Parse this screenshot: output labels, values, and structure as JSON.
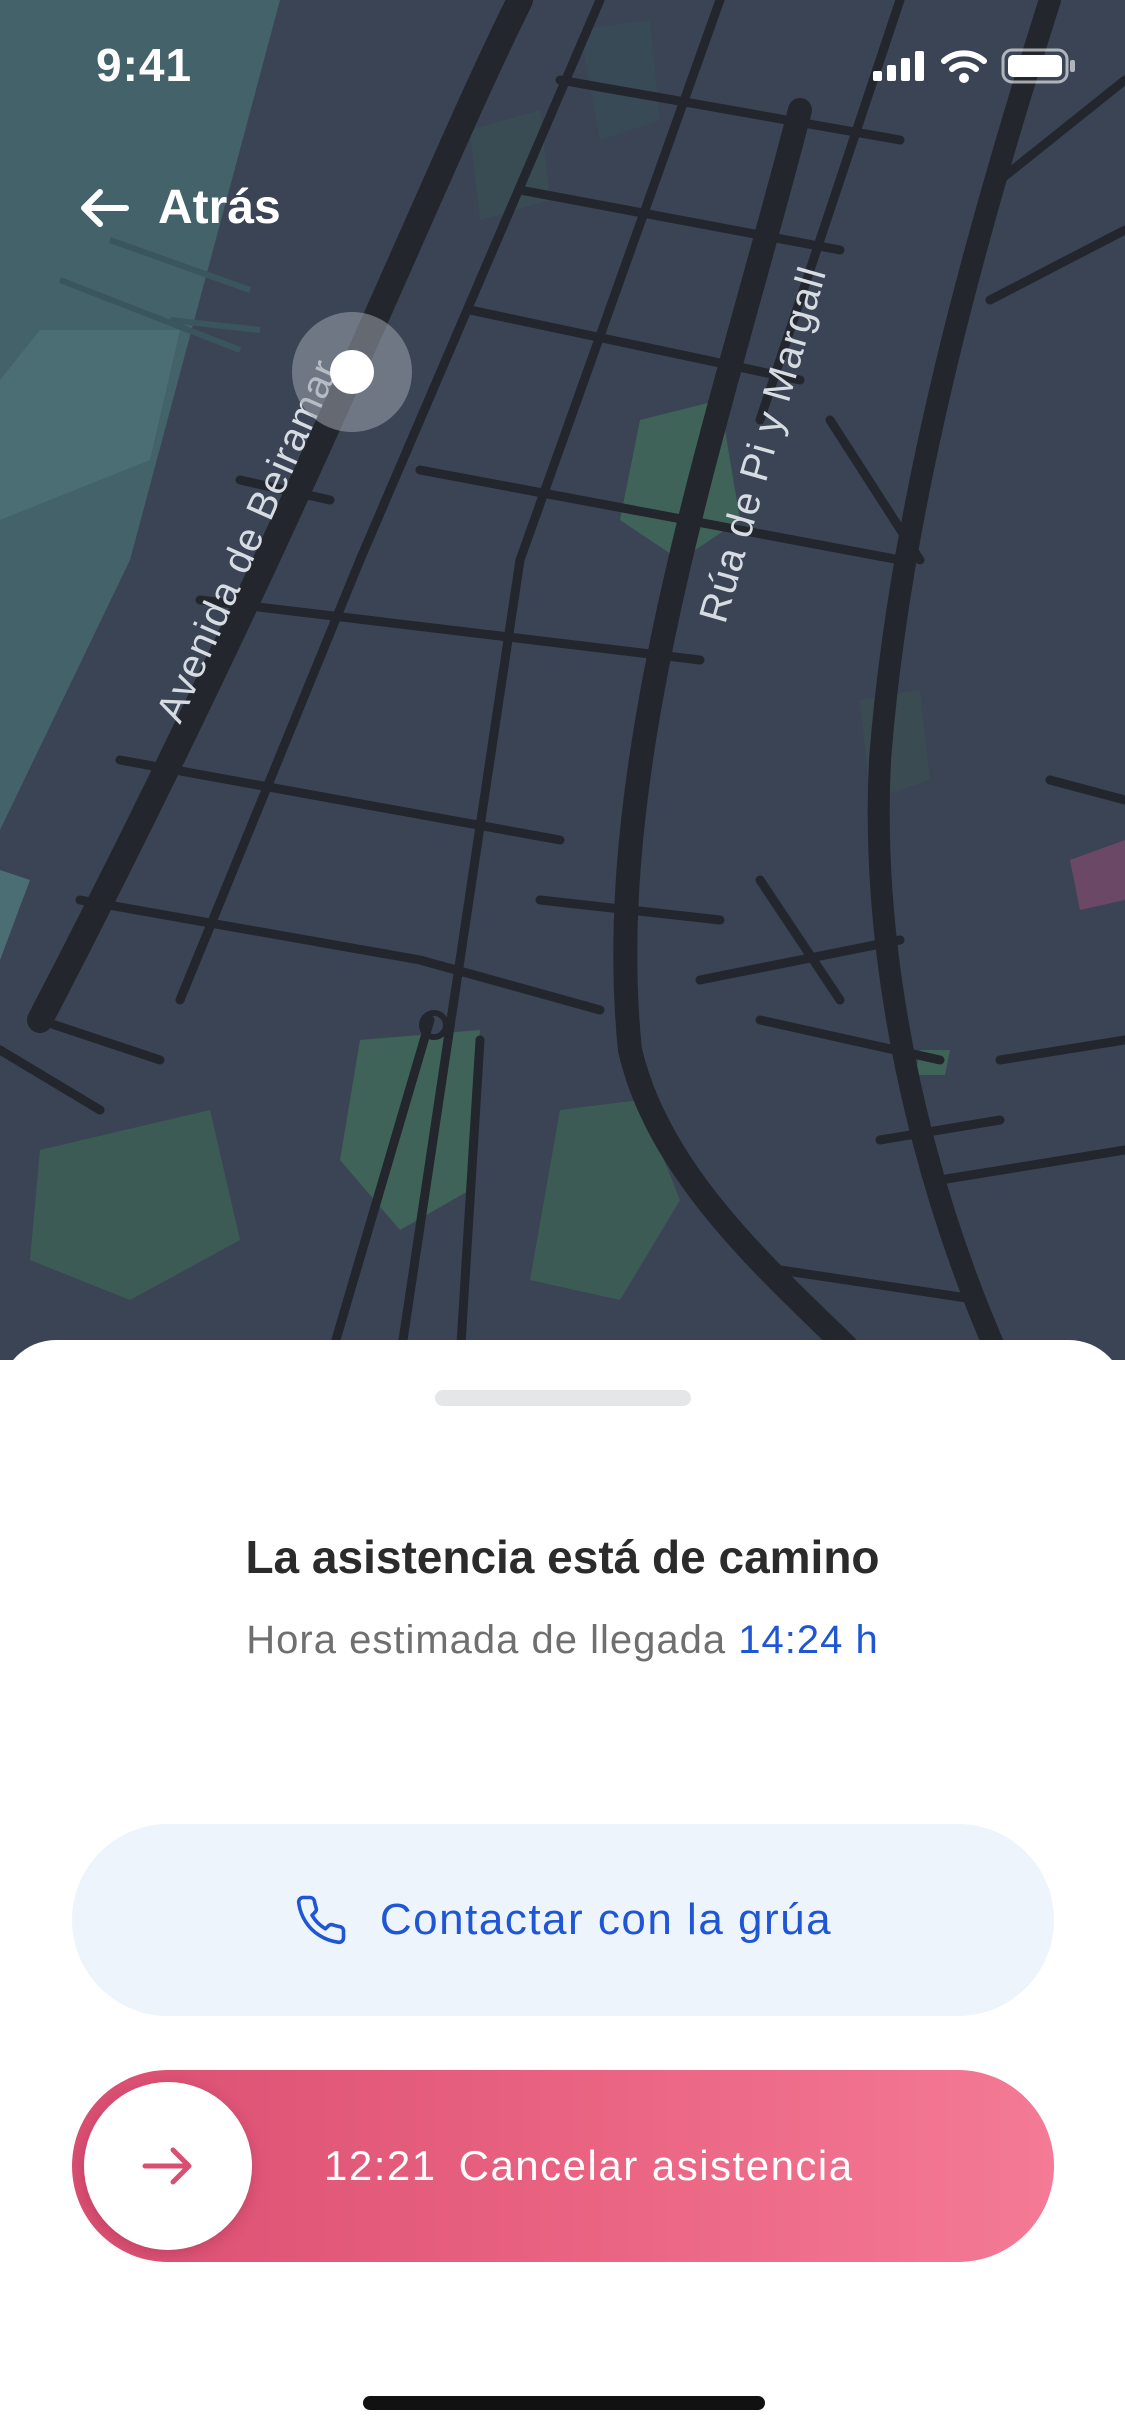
{
  "status_bar": {
    "time": "9:41"
  },
  "nav": {
    "back_label": "Atrás"
  },
  "map": {
    "street_labels": [
      "Avenida de Beiramar",
      "Rúa de Pi y Margall"
    ]
  },
  "sheet": {
    "title": "La asistencia está de camino",
    "eta_label": "Hora estimada de llegada",
    "eta_value": "14:24 h",
    "contact_label": "Contactar con la grúa",
    "cancel_time": "12:21",
    "cancel_label": "Cancelar asistencia"
  },
  "colors": {
    "accent_blue": "#1f56d6",
    "cancel_pink": "#e8607f",
    "map_bg": "#3b4455"
  },
  "icons": [
    "back-arrow-icon",
    "phone-icon",
    "right-arrow-icon",
    "signal-icon",
    "wifi-icon",
    "battery-icon",
    "location-dot-icon"
  ]
}
